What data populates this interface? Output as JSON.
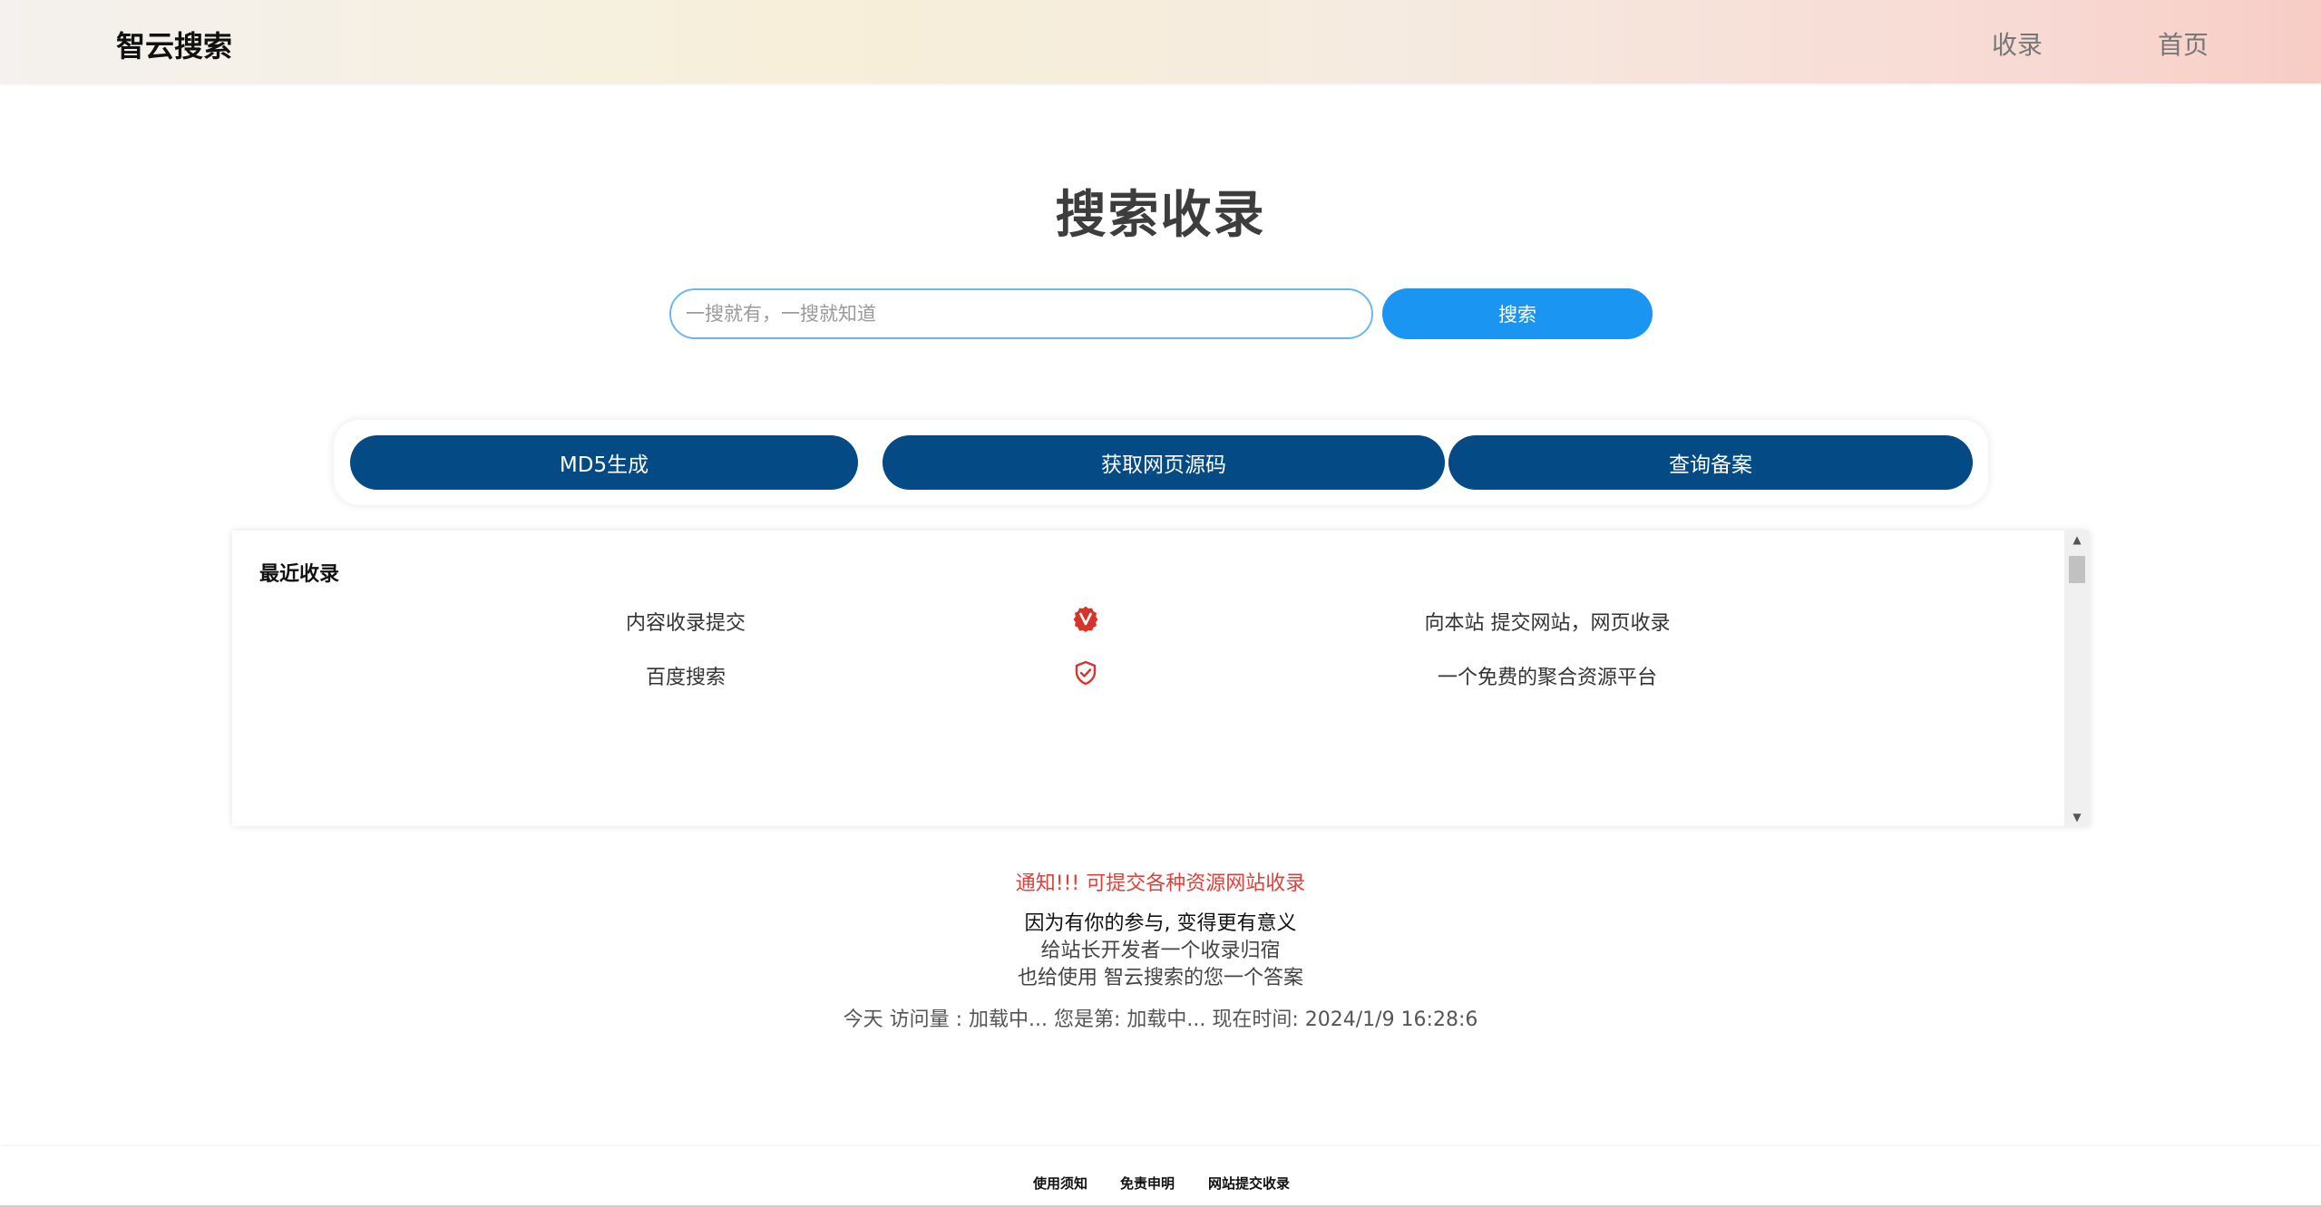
{
  "header": {
    "brand": "智云搜索",
    "nav": [
      {
        "label": "收录"
      },
      {
        "label": "首页"
      }
    ]
  },
  "hero": {
    "title": "搜索收录",
    "search_placeholder": "一搜就有，一搜就知道",
    "search_value": "",
    "search_button": "搜索"
  },
  "tools": [
    {
      "label": "MD5生成"
    },
    {
      "label": "获取网页源码"
    },
    {
      "label": "查询备案"
    }
  ],
  "recent": {
    "title": "最近收录",
    "items": [
      {
        "name": "内容收录提交",
        "icon": "verified-v-badge-icon",
        "desc": "向本站 提交网站，网页收录"
      },
      {
        "name": "百度搜索",
        "icon": "shield-check-icon",
        "desc": "一个免费的聚合资源平台"
      }
    ]
  },
  "notice": {
    "headline": "通知!!! 可提交各种资源网站收录",
    "line1": "因为有你的参与, 变得更有意义",
    "line2": "给站长开发者一个收录归宿",
    "line3": "也给使用 智云搜索的您一个答案",
    "stats": "今天 访问量 : 加载中... 您是第: 加载中... 现在时间: 2024/1/9 16:28:6"
  },
  "footer": {
    "links": [
      {
        "label": "使用须知"
      },
      {
        "label": "免责申明"
      },
      {
        "label": "网站提交收录"
      }
    ]
  },
  "colors": {
    "accent": "#1a95f2",
    "tool_button": "#044a84",
    "notice": "#e0403a",
    "icon_red": "#d9342b"
  }
}
